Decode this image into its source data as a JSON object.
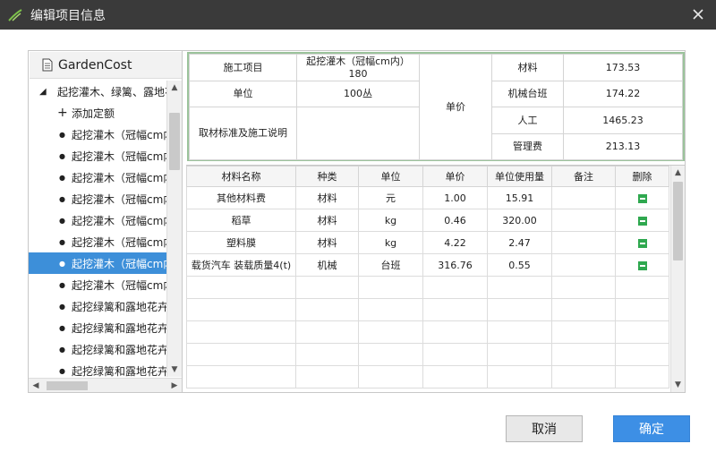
{
  "window": {
    "title": "编辑项目信息"
  },
  "tree": {
    "root": "GardenCost",
    "items": [
      {
        "kind": "group",
        "label": "起挖灌木、绿篱、露地花卉"
      },
      {
        "kind": "add",
        "label": "添加定额"
      },
      {
        "kind": "leaf",
        "label": "起挖灌木（冠幅cm内）"
      },
      {
        "kind": "leaf",
        "label": "起挖灌木（冠幅cm内）"
      },
      {
        "kind": "leaf",
        "label": "起挖灌木（冠幅cm内）"
      },
      {
        "kind": "leaf",
        "label": "起挖灌木（冠幅cm内）"
      },
      {
        "kind": "leaf",
        "label": "起挖灌木（冠幅cm内）"
      },
      {
        "kind": "leaf",
        "label": "起挖灌木（冠幅cm内）"
      },
      {
        "kind": "leaf",
        "label": "起挖灌木（冠幅cm内）",
        "selected": true
      },
      {
        "kind": "leaf",
        "label": "起挖灌木（冠幅cm内）"
      },
      {
        "kind": "leaf",
        "label": "起挖绿篱和露地花卉"
      },
      {
        "kind": "leaf",
        "label": "起挖绿篱和露地花卉"
      },
      {
        "kind": "leaf",
        "label": "起挖绿篱和露地花卉"
      },
      {
        "kind": "leaf",
        "label": "起挖绿篱和露地花卉"
      }
    ]
  },
  "info": {
    "project_label": "施工项目",
    "project_value": "起挖灌木（冠幅cm内） 180",
    "unit_label": "单位",
    "unit_value": "100丛",
    "desc_label": "取材标准及施工说明",
    "desc_value": "",
    "price_label": "单价",
    "costs": [
      {
        "label": "材料",
        "value": "173.53"
      },
      {
        "label": "机械台班",
        "value": "174.22"
      },
      {
        "label": "人工",
        "value": "1465.23"
      },
      {
        "label": "管理费",
        "value": "213.13"
      }
    ]
  },
  "grid": {
    "headers": [
      "材料名称",
      "种类",
      "单位",
      "单价",
      "单位使用量",
      "备注",
      "删除"
    ],
    "rows": [
      {
        "name": "其他材料费",
        "type": "材料",
        "unit": "元",
        "price": "1.00",
        "usage": "15.91",
        "note": ""
      },
      {
        "name": "稻草",
        "type": "材料",
        "unit": "kg",
        "price": "0.46",
        "usage": "320.00",
        "note": ""
      },
      {
        "name": "塑料膜",
        "type": "材料",
        "unit": "kg",
        "price": "4.22",
        "usage": "2.47",
        "note": ""
      },
      {
        "name": "载货汽车 装载质量4(t)",
        "type": "机械",
        "unit": "台班",
        "price": "316.76",
        "usage": "0.55",
        "note": ""
      }
    ],
    "empty_rows": 5
  },
  "buttons": {
    "cancel": "取消",
    "ok": "确定"
  },
  "colors": {
    "selection": "#3d8fd9",
    "accent": "#3d8fe5",
    "delete": "#2fa84f",
    "titlebar": "#3a3a3a"
  }
}
